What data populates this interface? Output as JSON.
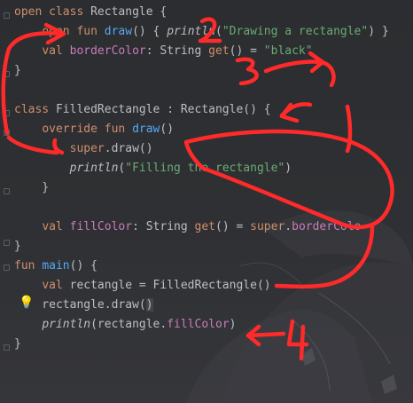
{
  "code_lines": [
    {
      "tokens": [
        {
          "t": "open ",
          "c": "kw"
        },
        {
          "t": "class ",
          "c": "kw"
        },
        {
          "t": "Rectangle {",
          "c": "pl"
        }
      ]
    },
    {
      "tokens": [
        {
          "t": "    ",
          "c": "pl"
        },
        {
          "t": "open ",
          "c": "kw"
        },
        {
          "t": "fun ",
          "c": "kw"
        },
        {
          "t": "draw",
          "c": "fn"
        },
        {
          "t": "() { ",
          "c": "pl"
        },
        {
          "t": "println",
          "c": "pl it"
        },
        {
          "t": "(",
          "c": "pl"
        },
        {
          "t": "\"Drawing a rectangle\"",
          "c": "st"
        },
        {
          "t": ") }",
          "c": "pl"
        }
      ]
    },
    {
      "tokens": [
        {
          "t": "    ",
          "c": "pl"
        },
        {
          "t": "val ",
          "c": "kw"
        },
        {
          "t": "borderColor",
          "c": "pr"
        },
        {
          "t": ": String ",
          "c": "pl"
        },
        {
          "t": "get",
          "c": "kw"
        },
        {
          "t": "() = ",
          "c": "pl"
        },
        {
          "t": "\"black\"",
          "c": "st"
        }
      ]
    },
    {
      "tokens": [
        {
          "t": "}",
          "c": "pl"
        }
      ]
    },
    {
      "tokens": []
    },
    {
      "tokens": [
        {
          "t": "class ",
          "c": "kw"
        },
        {
          "t": "FilledRectangle : Rectangle() {",
          "c": "pl"
        }
      ]
    },
    {
      "tokens": [
        {
          "t": "    ",
          "c": "pl"
        },
        {
          "t": "override ",
          "c": "kw"
        },
        {
          "t": "fun ",
          "c": "kw"
        },
        {
          "t": "draw",
          "c": "fn"
        },
        {
          "t": "()",
          "c": "pl"
        }
      ]
    },
    {
      "tokens": [
        {
          "t": "        ",
          "c": "pl"
        },
        {
          "t": "super",
          "c": "kw"
        },
        {
          "t": ".draw()",
          "c": "pl"
        }
      ]
    },
    {
      "tokens": [
        {
          "t": "        ",
          "c": "pl"
        },
        {
          "t": "println",
          "c": "pl it"
        },
        {
          "t": "(",
          "c": "pl"
        },
        {
          "t": "\"Filling the rectangle\"",
          "c": "st"
        },
        {
          "t": ")",
          "c": "pl"
        }
      ]
    },
    {
      "tokens": [
        {
          "t": "    }",
          "c": "pl"
        }
      ]
    },
    {
      "tokens": []
    },
    {
      "tokens": [
        {
          "t": "    ",
          "c": "pl"
        },
        {
          "t": "val ",
          "c": "kw"
        },
        {
          "t": "fillColor",
          "c": "pr"
        },
        {
          "t": ": String ",
          "c": "pl"
        },
        {
          "t": "get",
          "c": "kw"
        },
        {
          "t": "() = ",
          "c": "pl"
        },
        {
          "t": "super",
          "c": "kw"
        },
        {
          "t": ".",
          "c": "pl"
        },
        {
          "t": "borderColo",
          "c": "pr"
        }
      ]
    },
    {
      "tokens": [
        {
          "t": "}",
          "c": "pl"
        }
      ]
    },
    {
      "tokens": [
        {
          "t": "fun ",
          "c": "kw"
        },
        {
          "t": "main",
          "c": "fn"
        },
        {
          "t": "() {",
          "c": "pl"
        }
      ]
    },
    {
      "tokens": [
        {
          "t": "    ",
          "c": "pl"
        },
        {
          "t": "val ",
          "c": "kw"
        },
        {
          "t": "rectangle = FilledRectangle()",
          "c": "pl"
        }
      ]
    },
    {
      "tokens": [
        {
          "t": "    rectangle.draw(",
          "c": "pl"
        },
        {
          "t": ")",
          "c": "pl cur"
        }
      ]
    },
    {
      "tokens": [
        {
          "t": "    ",
          "c": "pl"
        },
        {
          "t": "println",
          "c": "pl it"
        },
        {
          "t": "(rectangle.",
          "c": "pl"
        },
        {
          "t": "fillColor",
          "c": "pr"
        },
        {
          "t": ")",
          "c": "pl"
        }
      ]
    },
    {
      "tokens": [
        {
          "t": "}",
          "c": "pl"
        }
      ]
    }
  ],
  "annotations": [
    "1",
    "2",
    "3",
    "4"
  ],
  "colors": {
    "keyword": "#cf8e6d",
    "function": "#56a8f5",
    "string": "#6aab73",
    "property": "#c77dbb",
    "plain": "#bcbec4",
    "ink": "#ff2a2a",
    "background": "#2b2d30"
  },
  "icons": {
    "intention": "lightbulb-icon",
    "fold": "fold-marker-icon"
  }
}
